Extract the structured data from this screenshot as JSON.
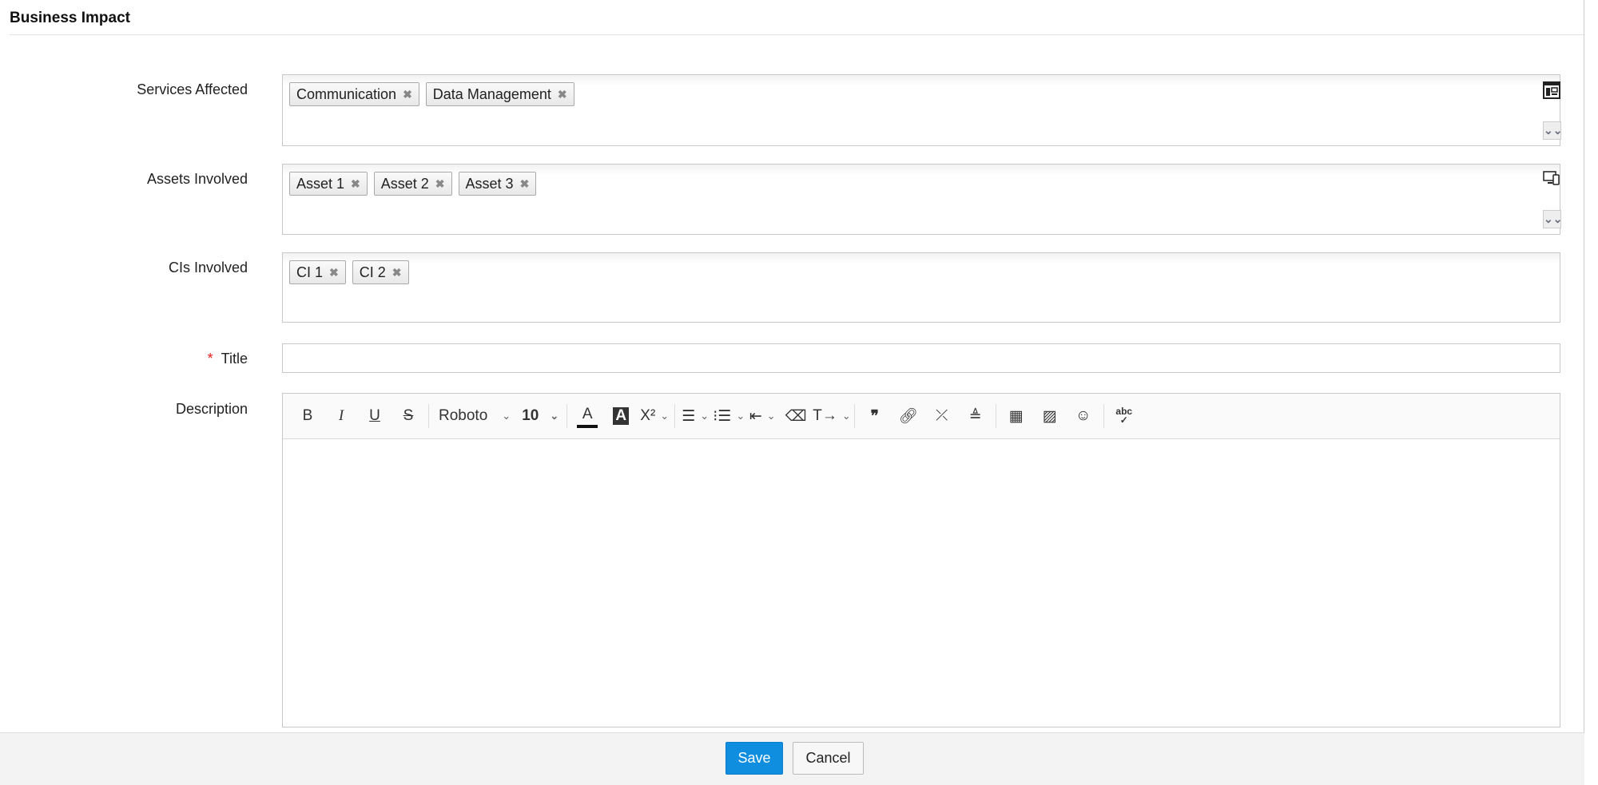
{
  "section_title": "Business Impact",
  "fields": {
    "services": {
      "label": "Services Affected",
      "tags": [
        "Communication",
        "Data Management"
      ]
    },
    "assets": {
      "label": "Assets Involved",
      "tags": [
        "Asset 1",
        "Asset 2",
        "Asset 3"
      ]
    },
    "cis": {
      "label": "CIs Involved",
      "tags": [
        "CI 1",
        "CI 2"
      ]
    },
    "title": {
      "label": "Title",
      "required_mark": "*",
      "value": ""
    },
    "description": {
      "label": "Description",
      "font": "Roboto",
      "size": "10",
      "superscript": "X²",
      "spellcheck": "abc"
    }
  },
  "tag_remove": "✖",
  "footer": {
    "save": "Save",
    "cancel": "Cancel"
  }
}
